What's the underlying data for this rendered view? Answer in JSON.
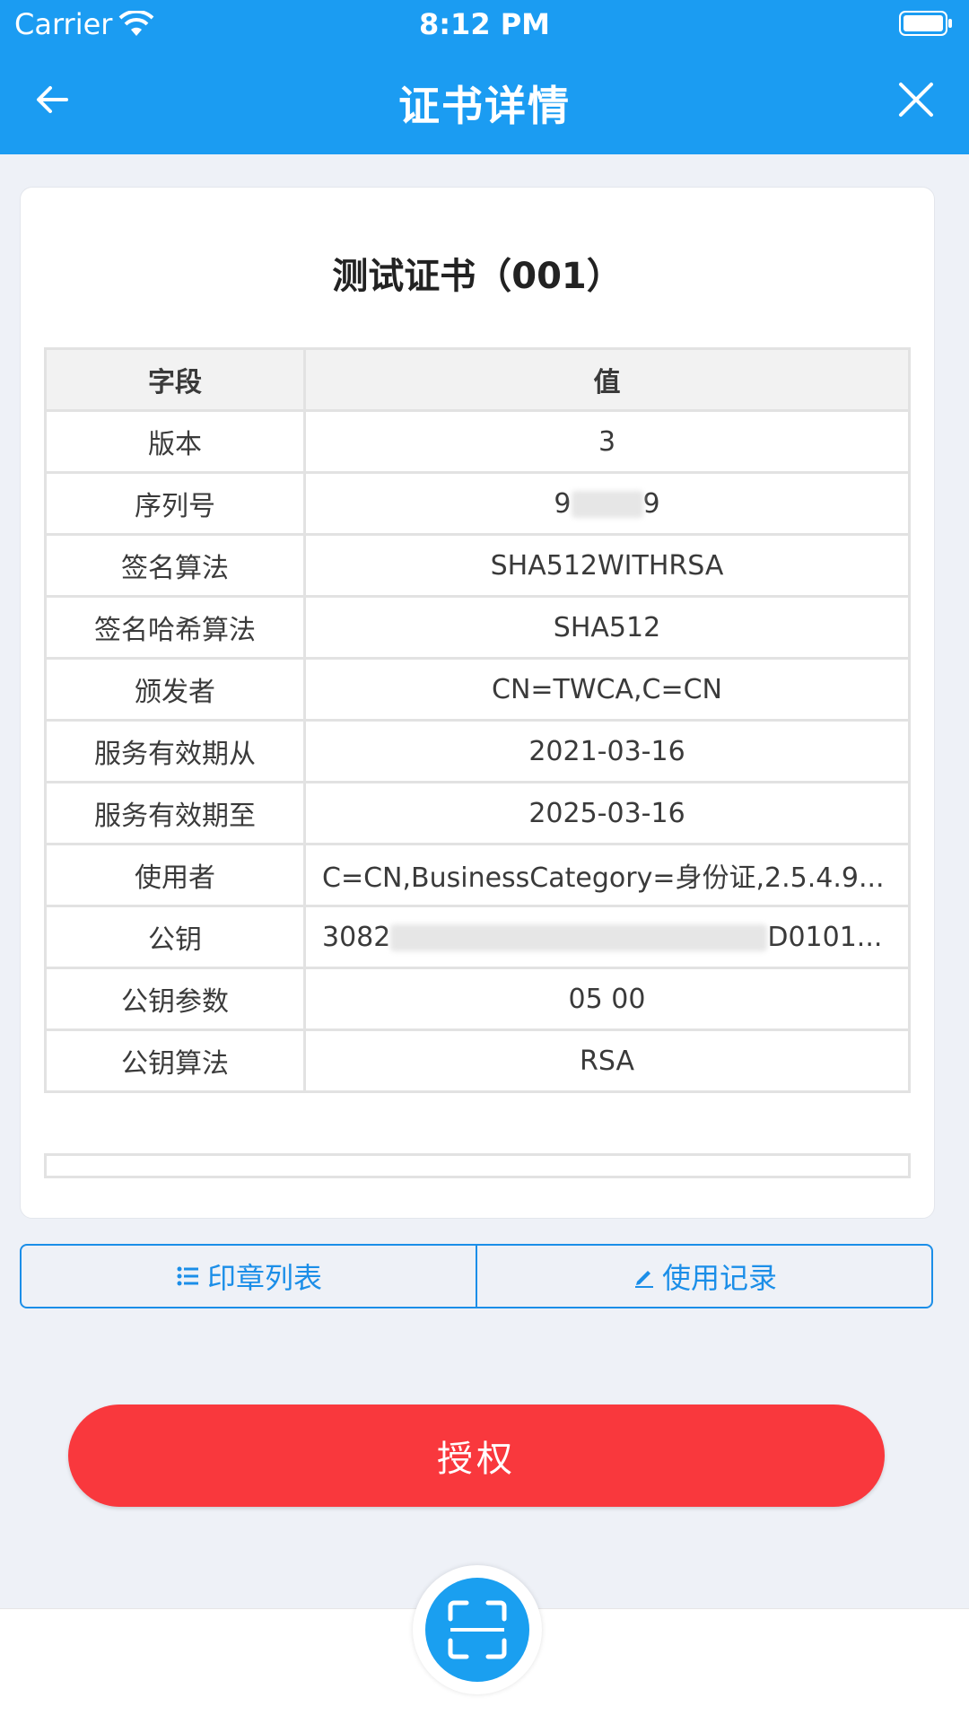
{
  "status": {
    "carrier": "Carrier",
    "time": "8:12 PM"
  },
  "nav": {
    "title": "证书详情"
  },
  "cert": {
    "title": "测试证书（001）",
    "header_field": "字段",
    "header_value": "值",
    "rows": [
      {
        "field": "版本",
        "value": "3"
      },
      {
        "field": "序列号",
        "value_prefix": "9",
        "value_suffix": "9"
      },
      {
        "field": "签名算法",
        "value": "SHA512WITHRSA"
      },
      {
        "field": "签名哈希算法",
        "value": "SHA512"
      },
      {
        "field": "颁发者",
        "value": "CN=TWCA,C=CN"
      },
      {
        "field": "服务有效期从",
        "value": "2021-03-16"
      },
      {
        "field": "服务有效期至",
        "value": "2025-03-16"
      },
      {
        "field": "使用者",
        "value": "C=CN,BusinessCategory=身份证,2.5.4.9..."
      },
      {
        "field": "公钥",
        "value_prefix": "3082",
        "value_suffix": "D0101..."
      },
      {
        "field": "公钥参数",
        "value": "05 00"
      },
      {
        "field": "公钥算法",
        "value": "RSA"
      }
    ]
  },
  "actions": {
    "seal_list": "印章列表",
    "usage_log": "使用记录",
    "authorize": "授权"
  },
  "icons": {
    "back": "back-arrow-icon",
    "close": "close-icon",
    "list": "list-icon",
    "edit": "pencil-icon",
    "scan": "scan-icon"
  },
  "colors": {
    "primary": "#1b9cf2",
    "danger": "#f9383d"
  }
}
